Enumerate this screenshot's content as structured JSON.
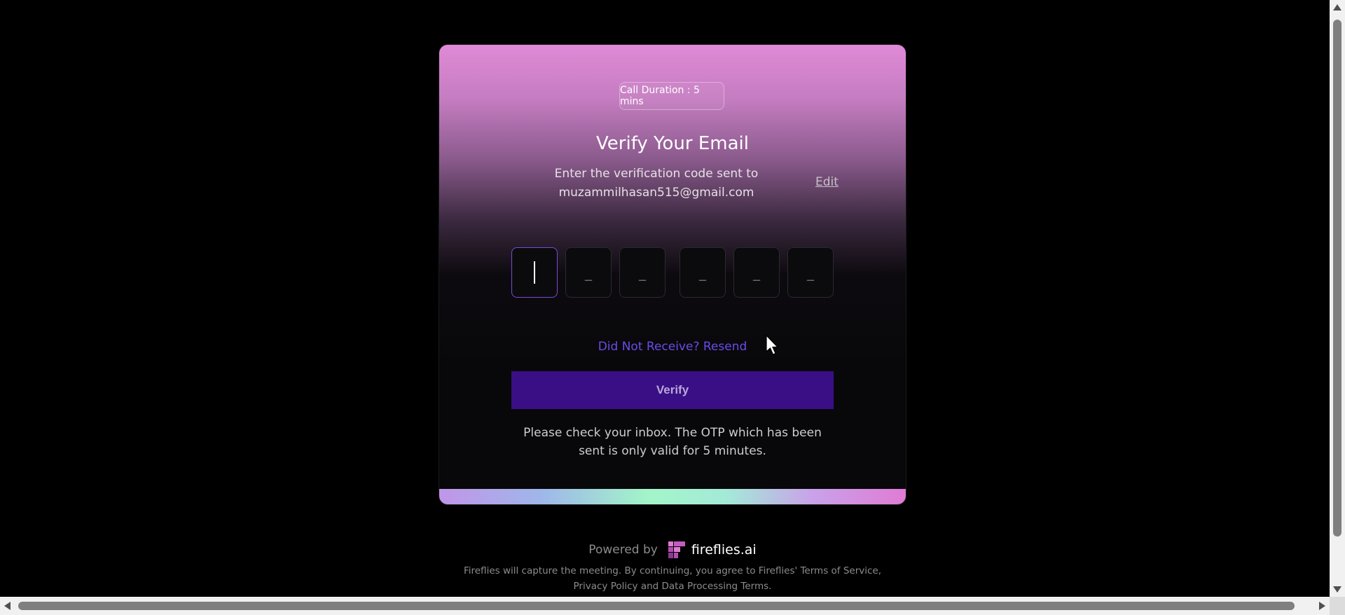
{
  "card": {
    "duration_badge": "Call Duration : 5 mins",
    "title": "Verify Your Email",
    "subtitle_line1": "Enter the verification code sent to",
    "email": "muzammilhasan515@gmail.com",
    "edit_label": "Edit",
    "otp": {
      "digits": [
        "",
        "_",
        "_",
        "_",
        "_",
        "_"
      ]
    },
    "resend_label": "Did Not Receive? Resend",
    "verify_label": "Verify",
    "inbox_note": "Please check your inbox. The OTP which has been sent is only valid for 5 minutes."
  },
  "footer": {
    "powered_by": "Powered by",
    "brand_name": "fireflies.ai",
    "legal": "Fireflies will capture the meeting. By continuing, you agree to Fireflies' Terms of Service, Privacy Policy and Data Processing Terms."
  },
  "colors": {
    "accent_purple": "#3a0f86",
    "resend_purple": "#6a4ce8",
    "brand_pink": "#e07bd4"
  },
  "icons": {
    "brand_logo": "fireflies-logo-icon",
    "cursor": "mouse-pointer-icon"
  }
}
